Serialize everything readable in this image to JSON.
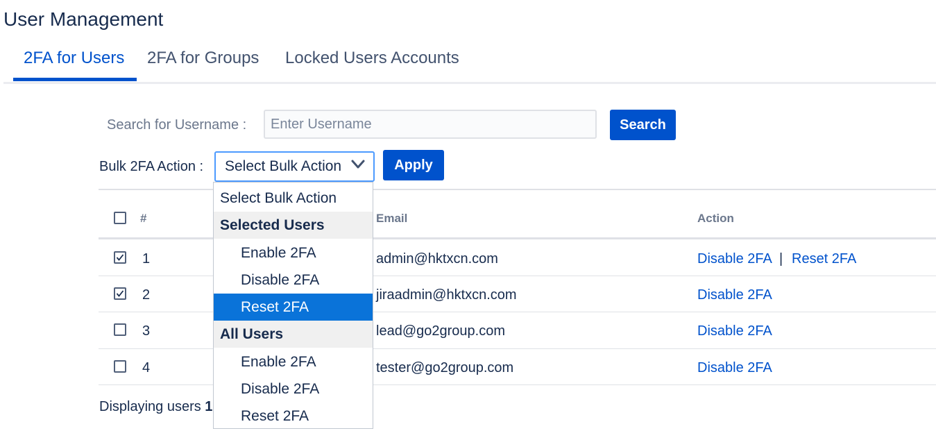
{
  "page": {
    "title": "User Management"
  },
  "tabs": [
    {
      "label": "2FA for Users",
      "active": true
    },
    {
      "label": "2FA for Groups",
      "active": false
    },
    {
      "label": "Locked Users Accounts",
      "active": false
    }
  ],
  "search": {
    "label": "Search for Username :",
    "placeholder": "Enter Username",
    "value": "",
    "button_label": "Search"
  },
  "bulk": {
    "label": "Bulk 2FA Action :",
    "selected": "Select Bulk Action",
    "apply_label": "Apply",
    "options": {
      "default": "Select Bulk Action",
      "selected_users": {
        "group_label": "Selected Users",
        "items": [
          "Enable 2FA",
          "Disable 2FA",
          "Reset 2FA"
        ],
        "highlighted": "Reset 2FA"
      },
      "all_users": {
        "group_label": "All Users",
        "items": [
          "Enable 2FA",
          "Disable 2FA",
          "Reset 2FA"
        ]
      }
    }
  },
  "table": {
    "headers": {
      "index": "#",
      "email": "Email",
      "action": "Action"
    },
    "rows": [
      {
        "index": "1",
        "email": "admin@hktxcn.com",
        "checked": true,
        "actions": [
          "Disable 2FA",
          "Reset 2FA"
        ]
      },
      {
        "index": "2",
        "email": "jiraadmin@hktxcn.com",
        "checked": true,
        "actions": [
          "Disable 2FA"
        ]
      },
      {
        "index": "3",
        "email": "lead@go2group.com",
        "checked": false,
        "actions": [
          "Disable 2FA"
        ]
      },
      {
        "index": "4",
        "email": "tester@go2group.com",
        "checked": false,
        "actions": [
          "Disable 2FA"
        ]
      }
    ],
    "action_separator": "|"
  },
  "footer": {
    "prefix": "Displaying users",
    "visible_count": "1"
  },
  "colors": {
    "accent": "#0052cc",
    "highlight": "#0a73d9",
    "text": "#172b4d",
    "muted": "#6b778c"
  },
  "icons": {
    "select_arrow": "chevron-down-icon",
    "checkmark": "checkmark-icon"
  }
}
